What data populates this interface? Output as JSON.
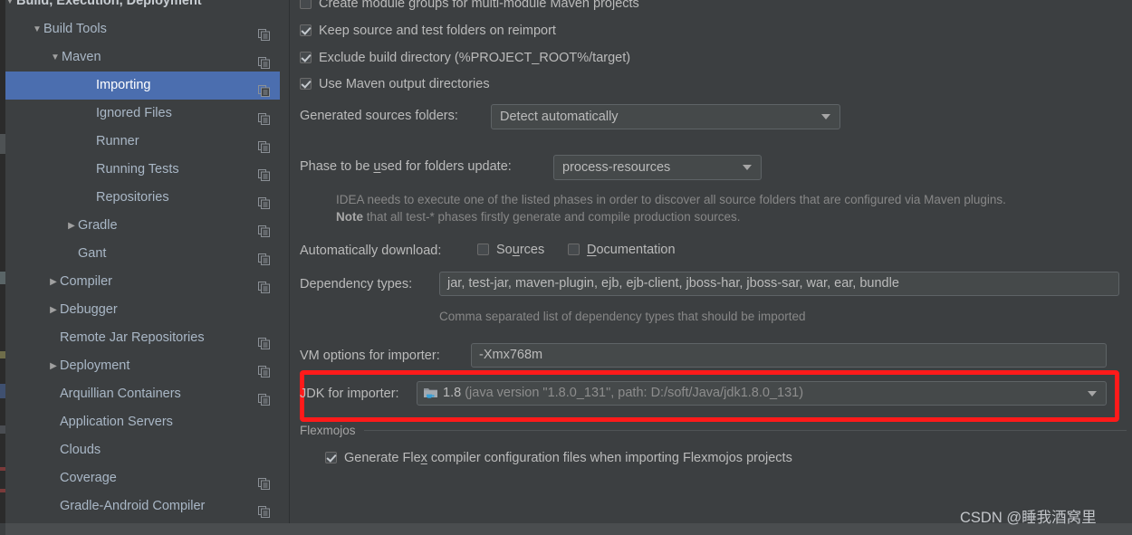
{
  "sidebar": {
    "items": [
      {
        "label": "Build, Execution, Deployment",
        "indent": 12,
        "arrow": "down",
        "bold": true,
        "copy": false,
        "selected": false
      },
      {
        "label": "Build Tools",
        "indent": 42,
        "arrow": "down",
        "bold": false,
        "copy": true,
        "selected": false
      },
      {
        "label": "Maven",
        "indent": 62,
        "arrow": "down",
        "bold": false,
        "copy": true,
        "selected": false
      },
      {
        "label": "Importing",
        "indent": 100,
        "arrow": "none",
        "bold": false,
        "copy": true,
        "selected": true
      },
      {
        "label": "Ignored Files",
        "indent": 100,
        "arrow": "none",
        "bold": false,
        "copy": true,
        "selected": false
      },
      {
        "label": "Runner",
        "indent": 100,
        "arrow": "none",
        "bold": false,
        "copy": true,
        "selected": false
      },
      {
        "label": "Running Tests",
        "indent": 100,
        "arrow": "none",
        "bold": false,
        "copy": true,
        "selected": false
      },
      {
        "label": "Repositories",
        "indent": 100,
        "arrow": "none",
        "bold": false,
        "copy": true,
        "selected": false
      },
      {
        "label": "Gradle",
        "indent": 80,
        "arrow": "right",
        "bold": false,
        "copy": true,
        "selected": false
      },
      {
        "label": "Gant",
        "indent": 80,
        "arrow": "none",
        "bold": false,
        "copy": true,
        "selected": false
      },
      {
        "label": "Compiler",
        "indent": 60,
        "arrow": "right",
        "bold": false,
        "copy": true,
        "selected": false
      },
      {
        "label": "Debugger",
        "indent": 60,
        "arrow": "right",
        "bold": false,
        "copy": false,
        "selected": false
      },
      {
        "label": "Remote Jar Repositories",
        "indent": 60,
        "arrow": "none",
        "bold": false,
        "copy": true,
        "selected": false
      },
      {
        "label": "Deployment",
        "indent": 60,
        "arrow": "right",
        "bold": false,
        "copy": true,
        "selected": false
      },
      {
        "label": "Arquillian Containers",
        "indent": 60,
        "arrow": "none",
        "bold": false,
        "copy": true,
        "selected": false
      },
      {
        "label": "Application Servers",
        "indent": 60,
        "arrow": "none",
        "bold": false,
        "copy": false,
        "selected": false
      },
      {
        "label": "Clouds",
        "indent": 60,
        "arrow": "none",
        "bold": false,
        "copy": false,
        "selected": false
      },
      {
        "label": "Coverage",
        "indent": 60,
        "arrow": "none",
        "bold": false,
        "copy": true,
        "selected": false
      },
      {
        "label": "Gradle-Android Compiler",
        "indent": 60,
        "arrow": "none",
        "bold": false,
        "copy": true,
        "selected": false
      }
    ]
  },
  "main": {
    "checkbox_create_module_groups": {
      "label": "Create module groups for multi-module Maven projects",
      "checked": false
    },
    "checkbox_keep_source": {
      "label": "Keep source and test folders on reimport",
      "checked": true
    },
    "checkbox_exclude_build": {
      "label": "Exclude build directory (%PROJECT_ROOT%/target)",
      "checked": true
    },
    "checkbox_use_maven_output": {
      "label": "Use Maven output directories",
      "checked": true
    },
    "generated_sources": {
      "label": "Generated sources folders:",
      "value": "Detect automatically"
    },
    "phase_update": {
      "label": "Phase to be used for folders update:",
      "value": "process-resources"
    },
    "hint_line1": "IDEA needs to execute one of the listed phases in order to discover all source folders that are configured via Maven plugins.",
    "hint_note_bold": "Note",
    "hint_line2_rest": " that all test-* phases firstly generate and compile production sources.",
    "auto_download": {
      "label": "Automatically download:",
      "sources": {
        "label": "Sources",
        "checked": false
      },
      "documentation": {
        "label": "Documentation",
        "checked": false
      }
    },
    "dependency_types": {
      "label": "Dependency types:",
      "value": "jar, test-jar, maven-plugin, ejb, ejb-client, jboss-har, jboss-sar, war, ear, bundle",
      "hint": "Comma separated list of dependency types that should be imported"
    },
    "vm_options": {
      "label": "VM options for importer:",
      "value": "-Xmx768m"
    },
    "jdk_importer": {
      "label": "JDK for importer:",
      "version": "1.8",
      "detail": "(java version \"1.8.0_131\", path: D:/soft/Java/jdk1.8.0_131)"
    },
    "flexmojos": {
      "title": "Flexmojos",
      "checkbox_generate_flex": {
        "label": "Generate Flex compiler configuration files when importing Flexmojos projects",
        "checked": true
      }
    }
  },
  "watermark": {
    "text": "CSDN @睡我酒窝里"
  },
  "colors": {
    "panel_bg": "#3c3f41",
    "selection_blue": "#4b6eaf",
    "highlight_red": "#ff1a1a",
    "field_bg": "#45494a",
    "text": "#bbbbbb",
    "hint_text": "#878787"
  }
}
